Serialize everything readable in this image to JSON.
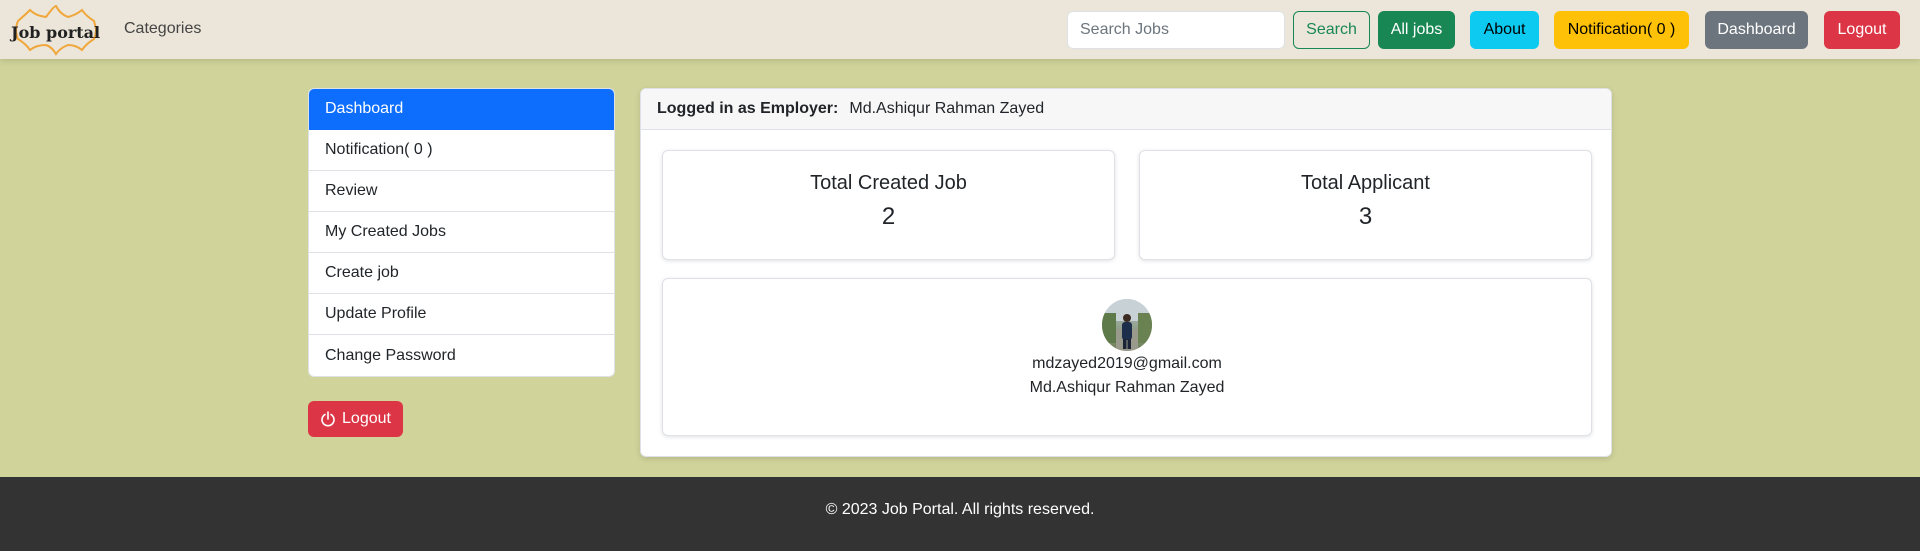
{
  "navbar": {
    "brand": "Job portal",
    "categories_label": "Categories",
    "search_placeholder": "Search Jobs",
    "search_button": "Search",
    "all_jobs_button": "All jobs",
    "about_button": "About",
    "notification_button": "Notification( 0 )",
    "dashboard_button": "Dashboard",
    "logout_button": "Logout"
  },
  "sidebar": {
    "items": [
      {
        "label": "Dashboard",
        "active": true
      },
      {
        "label": "Notification( 0 )"
      },
      {
        "label": "Review"
      },
      {
        "label": "My Created Jobs"
      },
      {
        "label": "Create job"
      },
      {
        "label": "Update Profile"
      },
      {
        "label": "Change Password"
      }
    ],
    "logout_label": "Logout"
  },
  "main": {
    "header_label": "Logged in as Employer:",
    "header_name": "Md.Ashiqur Rahman Zayed",
    "stats": [
      {
        "title": "Total Created Job",
        "value": "2"
      },
      {
        "title": "Total Applicant",
        "value": "3"
      }
    ],
    "profile": {
      "email": "mdzayed2019@gmail.com",
      "name": "Md.Ashiqur Rahman Zayed"
    }
  },
  "footer": {
    "text": "© 2023 Job Portal. All rights reserved."
  },
  "colors": {
    "page_bg": "#d0d39a",
    "navbar_bg": "#ebe6d9",
    "primary": "#0d6efd",
    "success": "#198754",
    "info": "#0dcaf0",
    "warning": "#ffc107",
    "secondary": "#6c757d",
    "danger": "#dc3545",
    "footer_bg": "#333333"
  }
}
